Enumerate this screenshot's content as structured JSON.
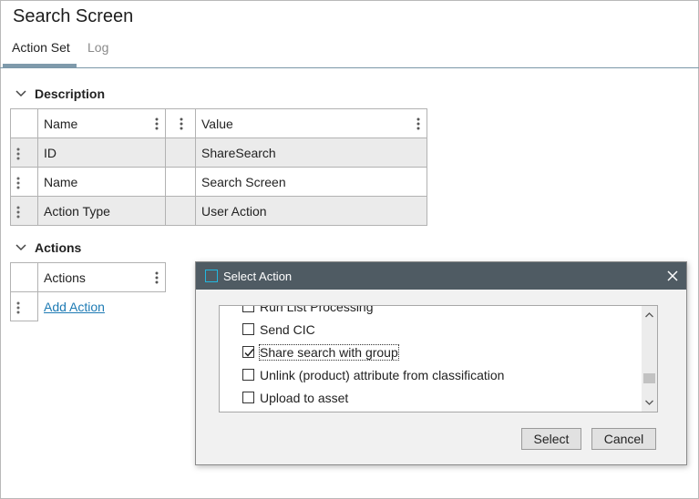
{
  "page": {
    "title": "Search Screen"
  },
  "tabs": [
    {
      "label": "Action Set",
      "active": true
    },
    {
      "label": "Log",
      "active": false
    }
  ],
  "description": {
    "heading": "Description",
    "columns": [
      "Name",
      "Value"
    ],
    "rows": [
      {
        "name": "ID",
        "value": "ShareSearch"
      },
      {
        "name": "Name",
        "value": "Search Screen"
      },
      {
        "name": "Action Type",
        "value": "User Action"
      }
    ]
  },
  "actions": {
    "heading": "Actions",
    "column": "Actions",
    "add_link": "Add Action"
  },
  "dialog": {
    "title": "Select Action",
    "items": [
      {
        "label": "Run List Processing",
        "checked": false
      },
      {
        "label": "Send CIC",
        "checked": false
      },
      {
        "label": "Share search with group",
        "checked": true
      },
      {
        "label": "Unlink (product) attribute from classification",
        "checked": false
      },
      {
        "label": "Upload to asset",
        "checked": false
      }
    ],
    "select_label": "Select",
    "cancel_label": "Cancel"
  },
  "colors": {
    "accent": "#1e7bb4",
    "titlebar": "#4f5b63",
    "icon_accent": "#22b8e0",
    "tab_underline": "#7f9aab"
  }
}
